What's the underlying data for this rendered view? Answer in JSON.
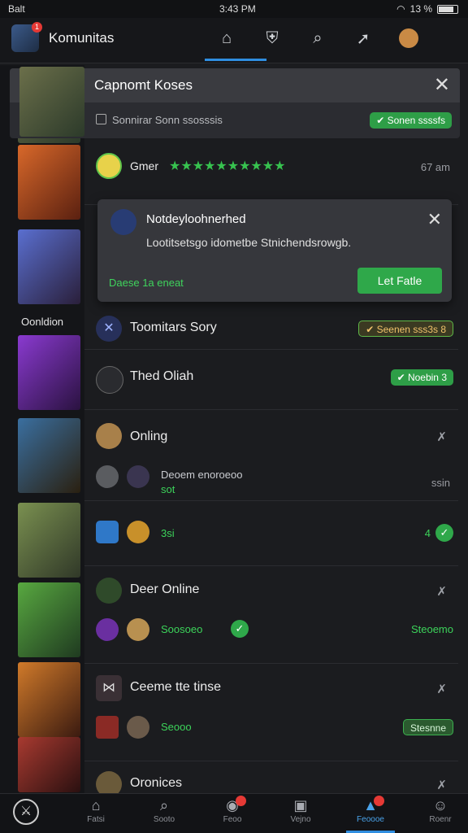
{
  "status_bar": {
    "carrier": "Balt",
    "time": "3:43 PM",
    "battery": "13 %"
  },
  "header": {
    "title": "Komunitas",
    "nav_icons": [
      "home-icon",
      "shield-icon",
      "search-icon",
      "rocket-icon",
      "profile-avatar",
      "profile-avatar-2"
    ],
    "notification_count": "1"
  },
  "top_card": {
    "title": "Capnomt Koses",
    "subtitle": "Sonnirar Sonn ssosssis",
    "pill": "✔ Sonen ssssfs"
  },
  "rail": {
    "label": "Oonldion"
  },
  "popup": {
    "title": "Notdeyloohnerhed",
    "text": "Lootitsetsgo idometbe Stnichendsrowgb.",
    "footer": "Daese 1a eneat",
    "button": "Let Fatle"
  },
  "rows": [
    {
      "title": "Gmer",
      "stars": "★★★★★★★★★★",
      "time": "67 am"
    },
    {
      "title": "Toomitars Sory",
      "pill": "✔ Seenen sss3s 8"
    },
    {
      "title": "Thed Oliah",
      "pill": "✔ Noebin 3"
    },
    {
      "title": "Onling",
      "sub_title": "Deoem enoroeoo",
      "sub_green": "sot",
      "time": "ssin"
    },
    {
      "sub_green": "3si",
      "count": "4"
    },
    {
      "title": "Deer Online",
      "sub_green": "Soosoeo",
      "right_green": "Steoemo"
    },
    {
      "title": "Ceeme tte tinse",
      "sub_green": "Seooo",
      "pill": "Stesnne"
    },
    {
      "title": "Oronices"
    }
  ],
  "bottom_nav": [
    {
      "label": "Fatsi",
      "icon": "bag-icon"
    },
    {
      "label": "Sooto",
      "icon": "search-icon"
    },
    {
      "label": "Feoo",
      "icon": "gamepad-icon"
    },
    {
      "label": "Vejno",
      "icon": "tv-icon"
    },
    {
      "label": "Feoooe",
      "icon": "bell-icon"
    },
    {
      "label": "Roenr",
      "icon": "user-icon"
    }
  ]
}
